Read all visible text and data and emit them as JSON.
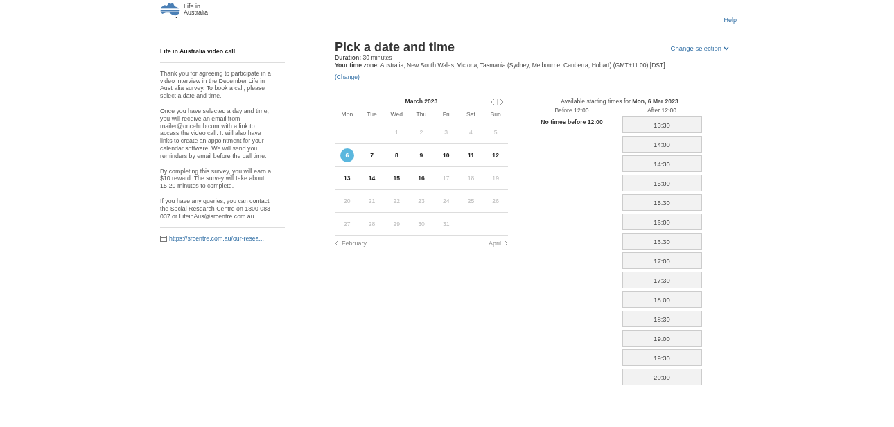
{
  "header": {
    "logo_lines": [
      "Life in",
      "Australia"
    ],
    "help": "Help"
  },
  "sidebar": {
    "title": "Life in Australia video call",
    "paragraphs": [
      "Thank you for agreeing to participate in a video interview in the December Life in Australia survey. To book a call, please select a date and time.",
      "Once you have selected a day and time, you will receive an email from mailer@oncehub.com with a link to access the video call. It will also have links to create an appointment for your calendar software. We will send you reminders by email before the call time.",
      "By completing this survey, you will earn a $10 reward. The survey will take about 15-20 minutes to complete.",
      "If you have any queries, you can contact the Social Research Centre on 1800 083 037 or LifeinAus@srcentre.com.au."
    ],
    "link": "https://srcentre.com.au/our-resea..."
  },
  "main": {
    "title": "Pick a date and time",
    "change_selection": "Change selection",
    "duration_label": "Duration:",
    "duration": "30 minutes",
    "timezone_label": "Your time zone:",
    "timezone": "Australia;  New South Wales, Victoria, Tasmania (Sydney, Melbourne, Canberra, Hobart)  (GMT+11:00) [DST]",
    "change_link": "(Change)"
  },
  "calendar": {
    "month": "March 2023",
    "weekdays": [
      "Mon",
      "Tue",
      "Wed",
      "Thu",
      "Fri",
      "Sat",
      "Sun"
    ],
    "prev_month": "February",
    "next_month": "April",
    "weeks": [
      [
        {
          "day": "1",
          "available": false,
          "selected": false
        },
        {
          "day": "2",
          "available": false,
          "selected": false
        },
        {
          "day": "3",
          "available": false,
          "selected": false
        },
        {
          "day": "4",
          "available": false,
          "selected": false
        },
        {
          "day": "5",
          "available": false,
          "selected": false
        }
      ],
      [
        {
          "day": "6",
          "available": true,
          "selected": true
        },
        {
          "day": "7",
          "available": true,
          "selected": false
        },
        {
          "day": "8",
          "available": true,
          "selected": false
        },
        {
          "day": "9",
          "available": true,
          "selected": false
        },
        {
          "day": "10",
          "available": true,
          "selected": false
        },
        {
          "day": "11",
          "available": true,
          "selected": false
        },
        {
          "day": "12",
          "available": true,
          "selected": false
        }
      ],
      [
        {
          "day": "13",
          "available": true,
          "selected": false
        },
        {
          "day": "14",
          "available": true,
          "selected": false
        },
        {
          "day": "15",
          "available": true,
          "selected": false
        },
        {
          "day": "16",
          "available": true,
          "selected": false
        },
        {
          "day": "17",
          "available": false,
          "selected": false
        },
        {
          "day": "18",
          "available": false,
          "selected": false
        },
        {
          "day": "19",
          "available": false,
          "selected": false
        }
      ],
      [
        {
          "day": "20",
          "available": false,
          "selected": false
        },
        {
          "day": "21",
          "available": false,
          "selected": false
        },
        {
          "day": "22",
          "available": false,
          "selected": false
        },
        {
          "day": "23",
          "available": false,
          "selected": false
        },
        {
          "day": "24",
          "available": false,
          "selected": false
        },
        {
          "day": "25",
          "available": false,
          "selected": false
        },
        {
          "day": "26",
          "available": false,
          "selected": false
        }
      ],
      [
        {
          "day": "27",
          "available": false,
          "selected": false
        },
        {
          "day": "28",
          "available": false,
          "selected": false
        },
        {
          "day": "29",
          "available": false,
          "selected": false
        },
        {
          "day": "30",
          "available": false,
          "selected": false
        },
        {
          "day": "31",
          "available": false,
          "selected": false
        }
      ]
    ]
  },
  "times": {
    "heading": "Available starting times for **Mon, 6 Mar 2023**",
    "before_label": "Before 12:00",
    "after_label": "After 12:00",
    "no_times": "No times before 12:00",
    "slots": [
      "13:30",
      "14:00",
      "14:30",
      "15:00",
      "15:30",
      "16:00",
      "16:30",
      "17:00",
      "17:30",
      "18:00",
      "18:30",
      "19:00",
      "19:30",
      "20:00"
    ]
  }
}
